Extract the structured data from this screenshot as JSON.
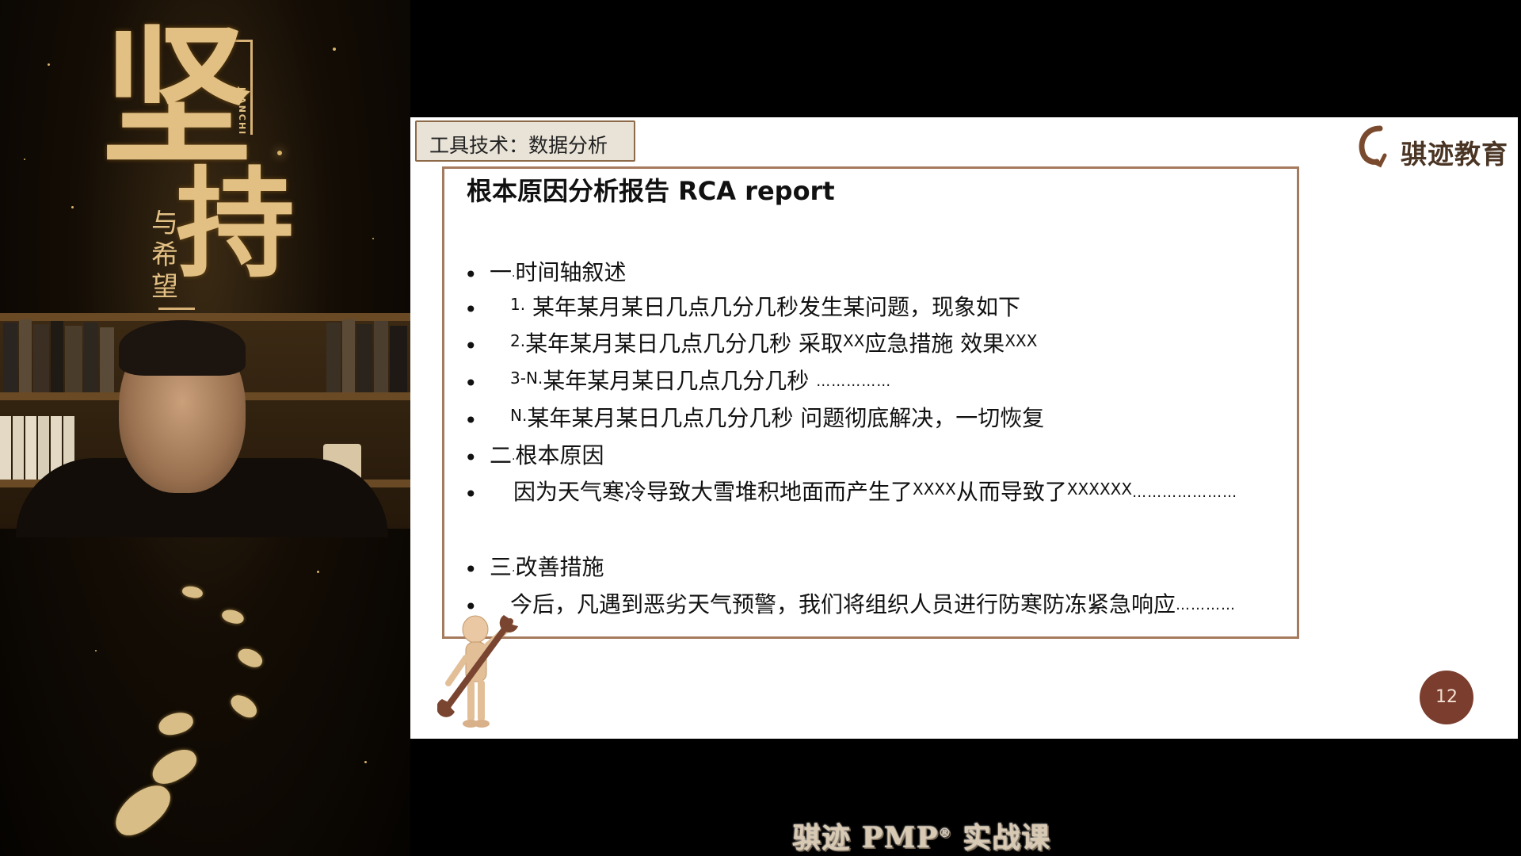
{
  "poster": {
    "big_char_1": "坚",
    "big_char_2": "持",
    "small_text": "与希望",
    "pinyin": "JIANCHI"
  },
  "slide": {
    "tool_tag": "工具技术：数据分析",
    "logo_text": "骐迹教育",
    "title": "根本原因分析报告 RCA report",
    "page_number": "12",
    "lines": [
      {
        "bullet": "•",
        "parts": [
          "一",
          "时间轴叙述"
        ]
      },
      {
        "bullet": "•",
        "parts": [
          "1.",
          "某年某月某日几点几分几秒发生某问题，现象如下"
        ]
      },
      {
        "bullet": "•",
        "parts": [
          "2.",
          "某年某月某日几点几分几秒 采取",
          "XX",
          "应急措施 效果",
          "XXX"
        ]
      },
      {
        "bullet": "•",
        "parts": [
          "3-N.",
          "某年某月某日几点几分几秒",
          "……………"
        ]
      },
      {
        "bullet": "•",
        "parts": [
          "N.",
          "某年某月某日几点几分几秒 问题彻底解决，一切恢复"
        ]
      },
      {
        "bullet": "•",
        "parts": [
          "二",
          "根本原因"
        ]
      },
      {
        "bullet": "•",
        "parts": [
          "因为天气寒冷导致大雪堆积地面而产生了",
          "XXXX",
          "从而导致了",
          "XXXXXX",
          "…………………"
        ]
      },
      {
        "bullet": "•",
        "parts": [
          "三",
          "改善措施"
        ]
      },
      {
        "bullet": "•",
        "parts": [
          "今后，凡遇到恶劣天气预警，我们将组织人员进行防寒防冻紧急响应",
          "…………"
        ]
      }
    ]
  },
  "banner": {
    "text_before": "骐迹 PMP",
    "reg_mark": "®",
    "text_after": " 实战课"
  },
  "colors": {
    "frame": "#a57a5d",
    "page_badge": "#7a3d2e",
    "poster_gold": "#e2c084"
  }
}
